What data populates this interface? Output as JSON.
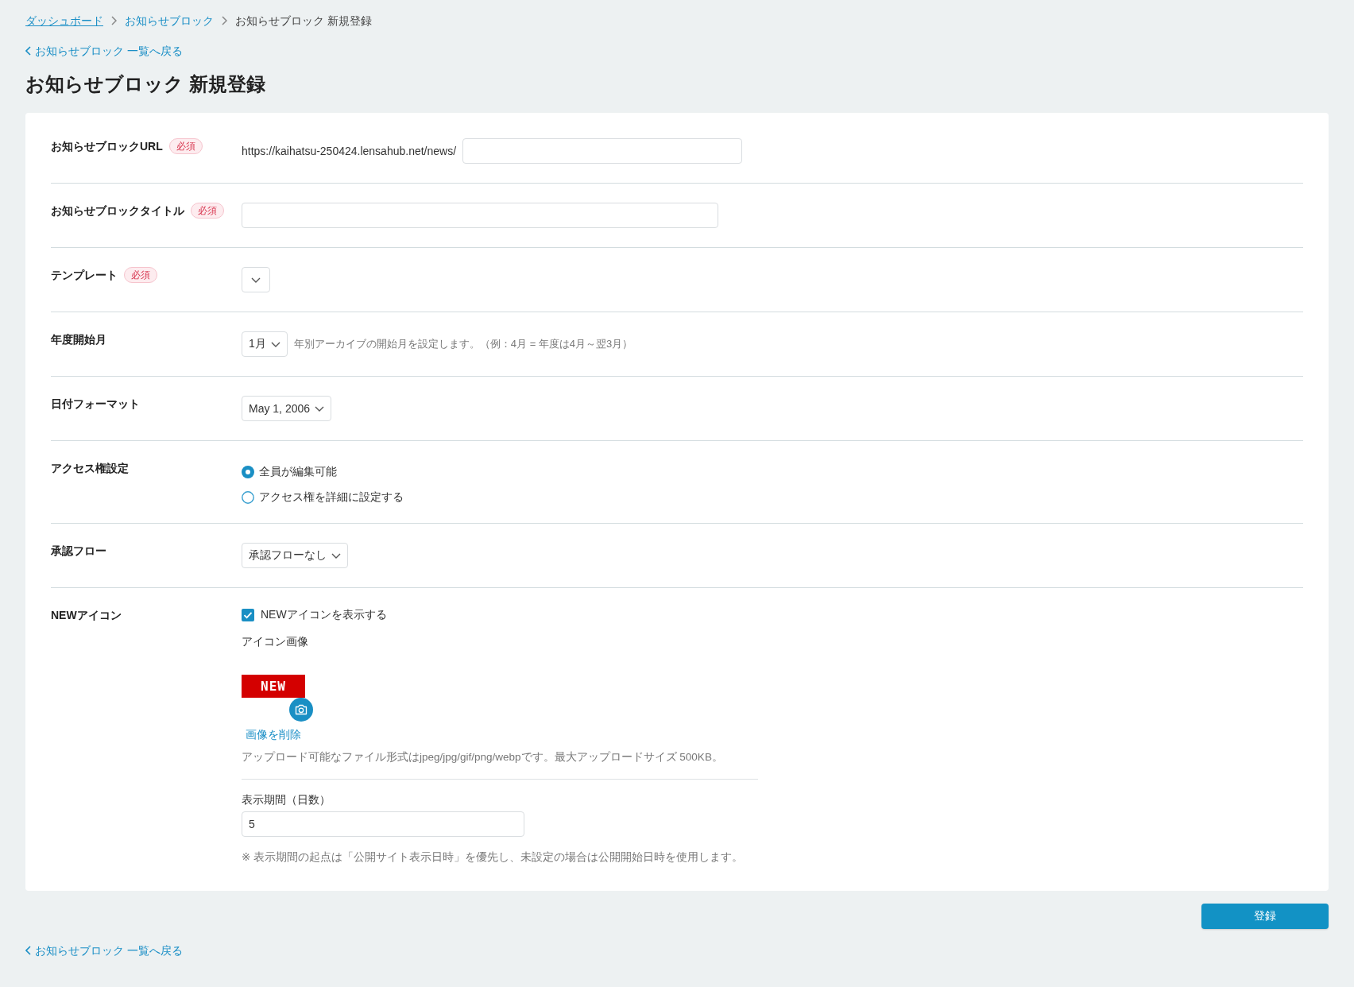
{
  "breadcrumbs": [
    {
      "kind": "link",
      "label": "ダッシュボード",
      "underlined": true
    },
    {
      "kind": "link",
      "label": "お知らせブロック",
      "underlined": false
    },
    {
      "kind": "current",
      "label": "お知らせブロック 新規登録"
    }
  ],
  "back_link_top": "お知らせブロック 一覧へ戻る",
  "page_title": "お知らせブロック 新規登録",
  "form": {
    "rows": [
      {
        "kind": "url_input",
        "label": "お知らせブロックURL",
        "required_badge": "必須",
        "prefix": "https://kaihatsu-250424.lensahub.net/news/"
      },
      {
        "kind": "text_input",
        "label": "お知らせブロックタイトル",
        "required_badge": "必須"
      },
      {
        "kind": "select",
        "label": "テンプレート",
        "required_badge": "必須"
      },
      {
        "kind": "select",
        "label": "年度開始月",
        "value": "1月",
        "hint": "年別アーカイブの開始月を設定します。（例：4月 = 年度は4月～翌3月）"
      },
      {
        "kind": "select",
        "label": "日付フォーマット",
        "value": "May 1, 2006"
      },
      {
        "kind": "radio",
        "label": "アクセス権設定",
        "options": [
          {
            "label": "全員が編集可能",
            "selected": true
          },
          {
            "label": "アクセス権を詳細に設定する",
            "selected": false
          }
        ]
      },
      {
        "kind": "select",
        "label": "承認フロー",
        "value": "承認フローなし"
      },
      {
        "kind": "new_icon",
        "label": "NEWアイコン",
        "checkbox": {
          "label": "NEWアイコンを表示する",
          "checked": true
        },
        "image_field": {
          "label": "アイコン画像",
          "preview_text": "NEW",
          "delete_link": "画像を削除",
          "note": "アップロード可能なファイル形式はjpeg/jpg/gif/png/webpです。最大アップロードサイズ 500KB。"
        },
        "period_field": {
          "label": "表示期間（日数）",
          "value": "5",
          "note": "※ 表示期間の起点は「公開サイト表示日時」を優先し、未設定の場合は公開開始日時を使用します。"
        }
      }
    ]
  },
  "submit_button": "登録",
  "back_link_bottom": "お知らせブロック 一覧へ戻る"
}
